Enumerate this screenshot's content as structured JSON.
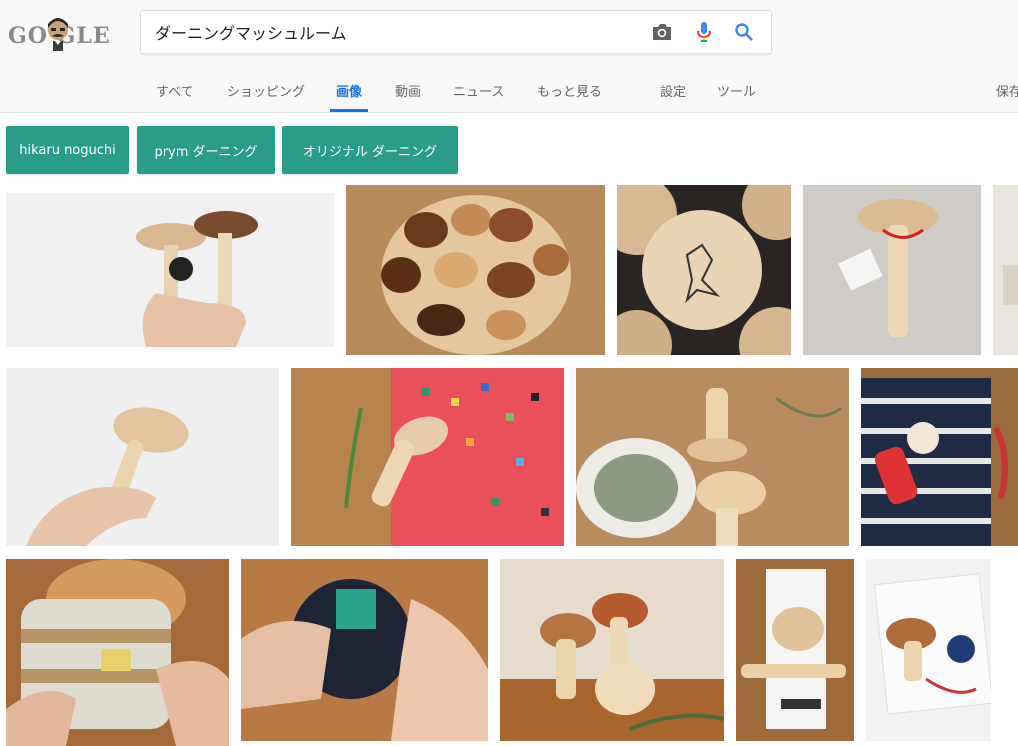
{
  "logo": {
    "text": "GO GLE"
  },
  "search": {
    "query": "ダーニングマッシュルーム"
  },
  "icons": {
    "camera": "camera-icon",
    "mic": "mic-icon",
    "search": "search-icon"
  },
  "tabs": [
    "すべて",
    "ショッピング",
    "画像",
    "動画",
    "ニュース",
    "もっと見る",
    "設定",
    "ツール",
    "保存"
  ],
  "active_tab": "画像",
  "chips": [
    "hikaru noguchi",
    "prym ダーニング",
    "オリジナル ダーニング"
  ],
  "colors": {
    "accent": "#1a73e8",
    "chip": "#2a9c8a",
    "header_bg": "#f8f8f8"
  },
  "results_count": 16
}
